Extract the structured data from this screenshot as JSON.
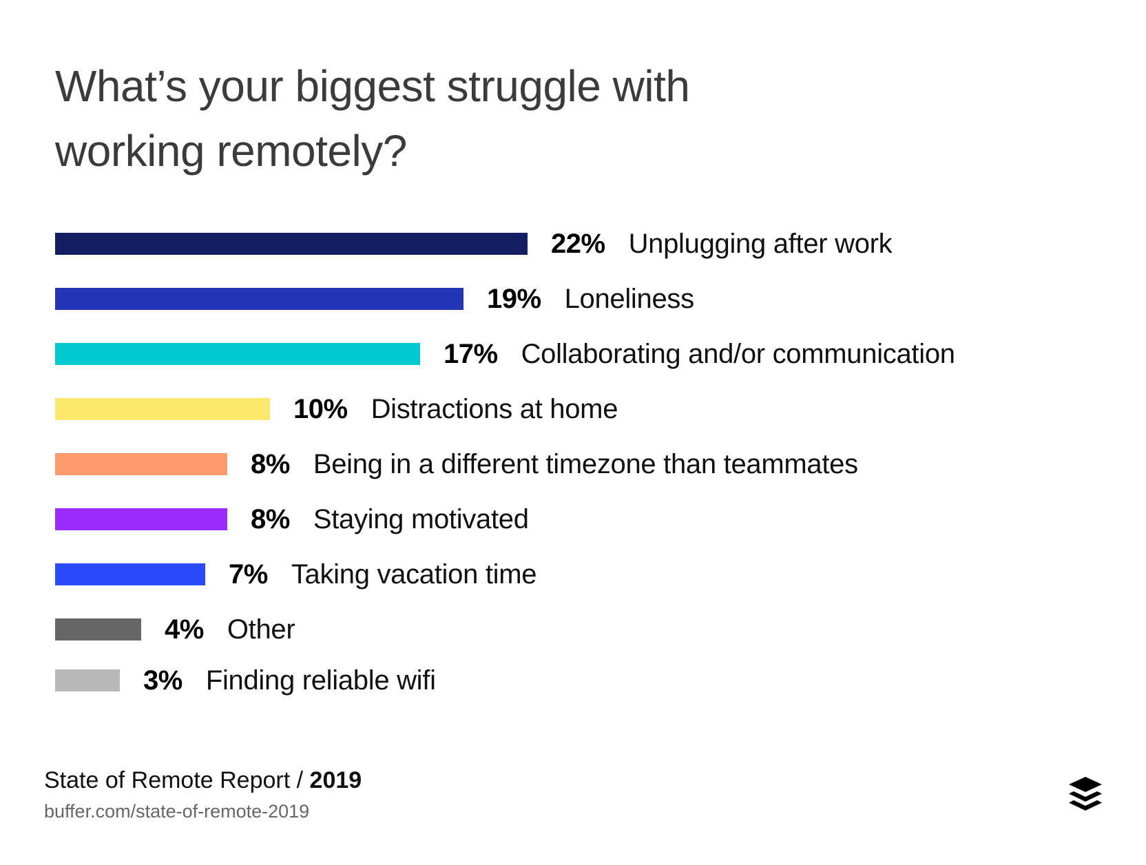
{
  "header": {
    "title_line1": "What’s your biggest struggle with",
    "title_line2": "working remotely?"
  },
  "footer": {
    "report_name": "State of Remote Report /",
    "report_year": "2019",
    "url": "buffer.com/state-of-remote-2019",
    "logo_icon": "buffer-stack-icon"
  },
  "chart_data": {
    "type": "bar",
    "orientation": "horizontal",
    "title": "What’s your biggest struggle with working remotely?",
    "xlabel": "",
    "ylabel": "",
    "xlim": [
      0,
      22
    ],
    "grid": false,
    "legend": "none",
    "categories": [
      "Unplugging after work",
      "Loneliness",
      "Collaborating and/or communication",
      "Distractions at home",
      "Being in a different timezone than teammates",
      "Staying motivated",
      "Taking vacation time",
      "Other",
      "Finding reliable wifi"
    ],
    "values": [
      22,
      19,
      17,
      10,
      8,
      8,
      7,
      4,
      3
    ],
    "value_labels": [
      "22%",
      "19%",
      "17%",
      "10%",
      "8%",
      "8%",
      "7%",
      "4%",
      "3%"
    ],
    "colors": [
      "#141f63",
      "#2335b5",
      "#00c8cf",
      "#fce86c",
      "#ff9a6a",
      "#9a2bfb",
      "#2b4bfb",
      "#666666",
      "#b8b8b8"
    ],
    "unit": "%"
  }
}
